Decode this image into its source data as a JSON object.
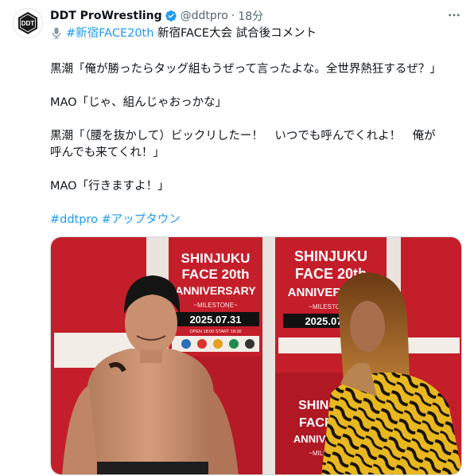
{
  "author": {
    "name": "DDT ProWrestling",
    "handle": "@ddtpro",
    "separator": "·",
    "time": "18分",
    "avatar_text": "DDT"
  },
  "tweet": {
    "hashtag_first": "#新宿FACE20th",
    "headline_rest": " 新宿FACE大会 試合後コメント",
    "lines": [
      "黒潮「俺が勝ったらタッグ組もうぜって言ったよな。全世界熱狂するぜ？」",
      "MAO「じゃ、組んじゃおっかな」",
      "黒潮「（腰を抜かして）ビックリしたー！　いつでも呼んでくれよ！　俺が",
      "呼んでも来てくれ！」",
      "MAO「行きますよ！」"
    ],
    "hashtags": [
      "#ddtpro",
      "#アップタウン"
    ]
  },
  "media": {
    "poster": {
      "line1": "SHINJUKU",
      "line2": "FACE 20th",
      "line3": "ANNIVERSARY",
      "subtitle": "~MILESTONE~",
      "date": "2025.07.31",
      "small": "OPEN 18:00 START 18:30"
    }
  },
  "icons": {
    "verified": "verified-badge-icon",
    "more": "more-icon",
    "mic": "microphone-icon"
  },
  "colors": {
    "accent": "#1d9bf0",
    "text": "#0f1419",
    "muted": "#536471",
    "poster_red": "#c41e2a"
  }
}
